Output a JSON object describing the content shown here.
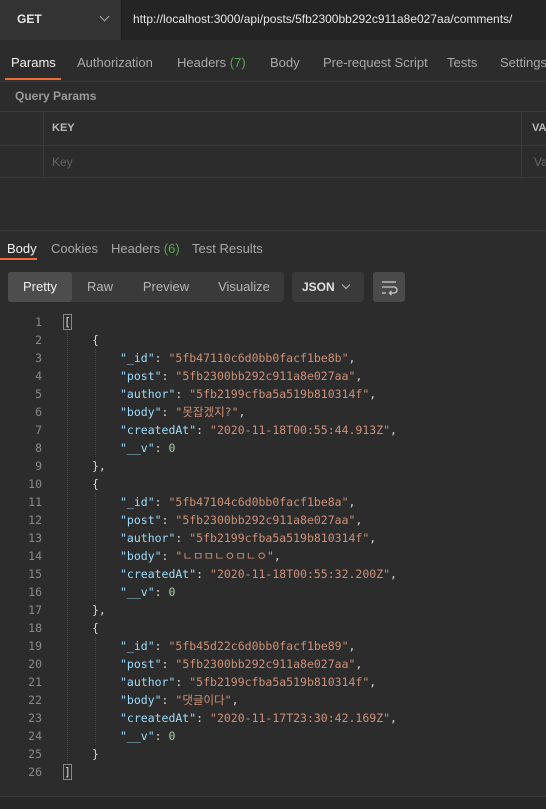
{
  "request": {
    "method": "GET",
    "url": "http://localhost:3000/api/posts/5fb2300bb292c911a8e027aa/comments/",
    "tabs": [
      {
        "label": "Params",
        "count": ""
      },
      {
        "label": "Authorization",
        "count": ""
      },
      {
        "label": "Headers",
        "count": "(7)"
      },
      {
        "label": "Body",
        "count": ""
      },
      {
        "label": "Pre-request Script",
        "count": ""
      },
      {
        "label": "Tests",
        "count": ""
      },
      {
        "label": "Settings",
        "count": ""
      }
    ],
    "active_tab": "Params",
    "query_params_title": "Query Params",
    "table": {
      "headers": [
        "KEY",
        "VA"
      ],
      "placeholders": [
        "Key",
        "Va"
      ]
    }
  },
  "response": {
    "tabs": [
      {
        "label": "Body",
        "count": ""
      },
      {
        "label": "Cookies",
        "count": ""
      },
      {
        "label": "Headers",
        "count": "(6)"
      },
      {
        "label": "Test Results",
        "count": ""
      }
    ],
    "active_tab": "Body",
    "view_modes": [
      "Pretty",
      "Raw",
      "Preview",
      "Visualize"
    ],
    "active_view": "Pretty",
    "format": "JSON",
    "comments": [
      {
        "_id": "5fb47110c6d0bb0facf1be8b",
        "post": "5fb2300bb292c911a8e027aa",
        "author": "5fb2199cfba5a519b810314f",
        "body": "못잡겠지?",
        "createdAt": "2020-11-18T00:55:44.913Z",
        "__v": 0
      },
      {
        "_id": "5fb47104c6d0bb0facf1be8a",
        "post": "5fb2300bb292c911a8e027aa",
        "author": "5fb2199cfba5a519b810314f",
        "body": "ㄴㅁㅁㄴㅇㅁㄴㅇ",
        "createdAt": "2020-11-18T00:55:32.200Z",
        "__v": 0
      },
      {
        "_id": "5fb45d22c6d0bb0facf1be89",
        "post": "5fb2300bb292c911a8e027aa",
        "author": "5fb2199cfba5a519b810314f",
        "body": "댓글이다",
        "createdAt": "2020-11-17T23:30:42.169Z",
        "__v": 0
      }
    ]
  },
  "icons": {
    "method_dropdown": "chevron-down-icon",
    "format_dropdown": "chevron-down-icon",
    "wrap": "wrap-lines-icon"
  }
}
